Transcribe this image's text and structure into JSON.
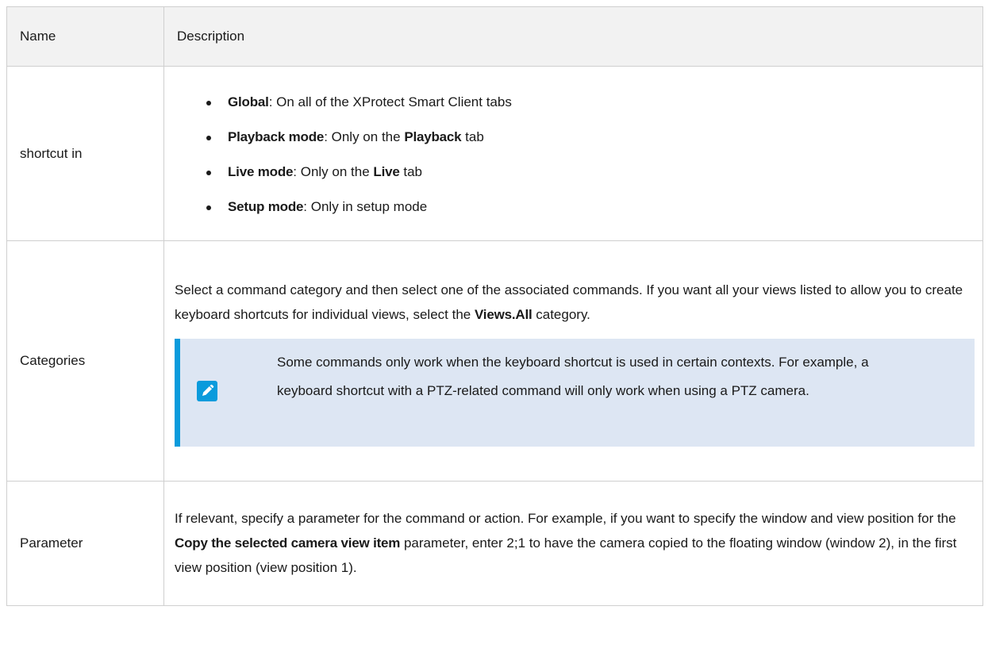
{
  "table": {
    "headers": {
      "name": "Name",
      "description": "Description"
    },
    "rows": {
      "shortcut_in": {
        "name": "shortcut in",
        "options": [
          {
            "label": "Global",
            "text": ": On all of the XProtect Smart Client tabs"
          },
          {
            "label": "Playback mode",
            "text1": ": Only on the ",
            "bold": "Playback",
            "text2": " tab"
          },
          {
            "label": "Live mode",
            "text1": ": Only on the ",
            "bold": "Live",
            "text2": " tab"
          },
          {
            "label": "Setup mode",
            "text": ": Only in setup mode"
          }
        ]
      },
      "categories": {
        "name": "Categories",
        "text_before": "Select a command category and then select one of the associated commands. If you want all your views listed to allow you to create keyboard shortcuts for individual views, select the ",
        "bold": "Views.All",
        "text_after": " category.",
        "note": {
          "icon": "pencil-note-icon",
          "text": "Some commands only work when the keyboard shortcut is used in certain contexts. For example, a keyboard shortcut with a PTZ-related command will only work when using a PTZ camera."
        }
      },
      "parameter": {
        "name": "Parameter",
        "text_before": "If relevant, specify a parameter for the command or action. For example, if you want to specify the window and view position for the ",
        "bold": "Copy the selected camera view item",
        "text_after": " parameter, enter 2;1 to have the camera copied to the floating window (window 2), in the first view position (view position 1)."
      }
    }
  },
  "colors": {
    "accent": "#0a9bdc",
    "note_bg": "#dde6f3",
    "header_bg": "#f2f2f2",
    "border": "#cfcfcf"
  }
}
